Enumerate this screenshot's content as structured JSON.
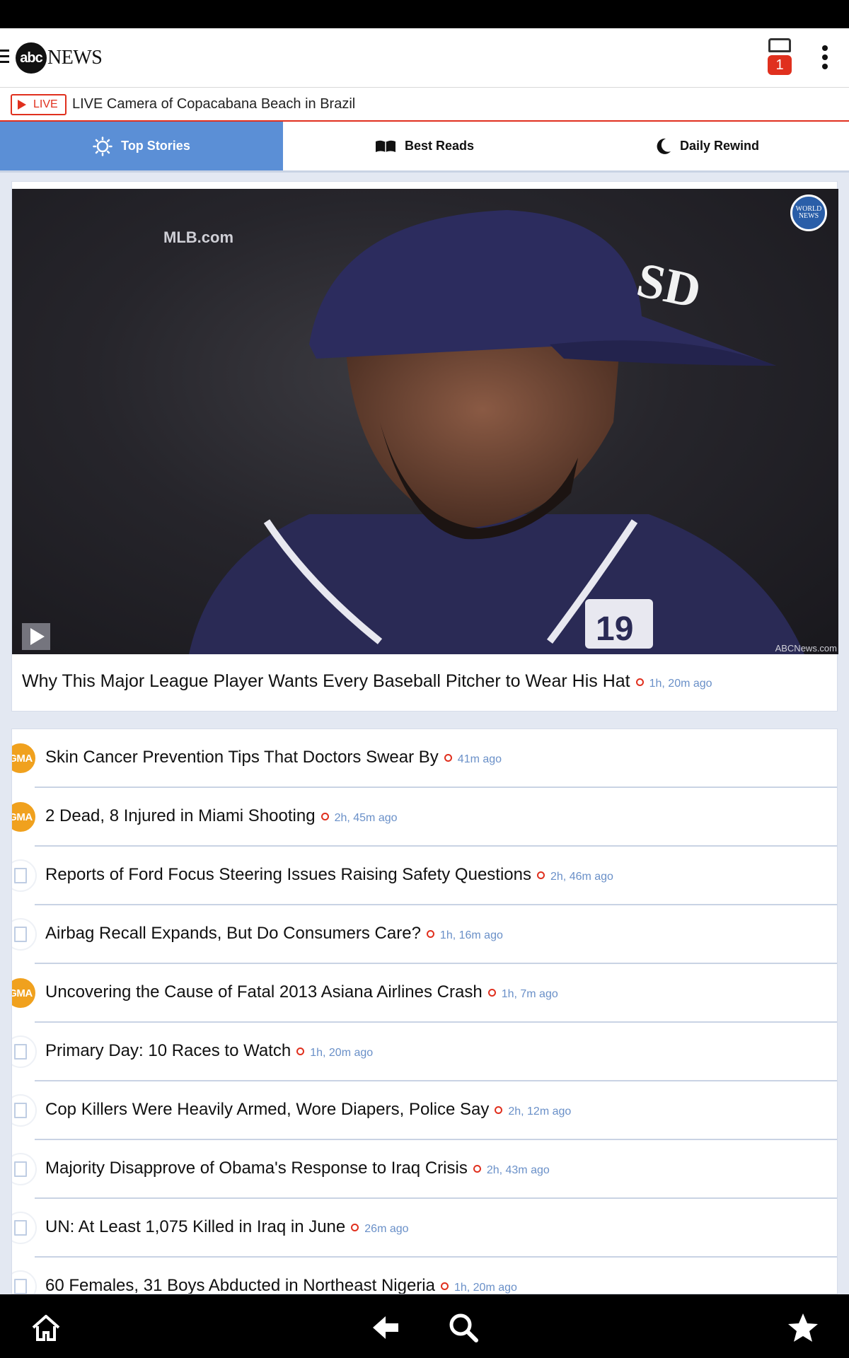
{
  "app": {
    "logo_mark": "abc",
    "logo_text": "NEWS",
    "notification_count": "1"
  },
  "live": {
    "badge_label": "LIVE",
    "text": "LIVE Camera of Copacabana Beach in Brazil"
  },
  "tabs": [
    {
      "label": "Top Stories",
      "icon": "sun-icon",
      "active": true
    },
    {
      "label": "Best Reads",
      "icon": "open-book-icon",
      "active": false
    },
    {
      "label": "Daily Rewind",
      "icon": "moon-icon",
      "active": false
    }
  ],
  "hero": {
    "watermark": "MLB.com",
    "badge_text_1": "WORLD",
    "badge_text_2": "NEWS",
    "credit": "ABCNews.com",
    "jersey_number": "19",
    "title": "Why This Major League Player Wants Every Baseball Pitcher to Wear His Hat",
    "time": "1h, 20m ago"
  },
  "stories": [
    {
      "title": "Skin Cancer Prevention Tips That Doctors Swear By",
      "time": "41m ago",
      "source": "gma"
    },
    {
      "title": "2 Dead, 8 Injured in Miami Shooting",
      "time": "2h, 45m ago",
      "source": "gma"
    },
    {
      "title": "Reports of Ford Focus Steering Issues Raising Safety Questions",
      "time": "2h, 46m ago",
      "source": "article"
    },
    {
      "title": "Airbag Recall Expands, But Do Consumers Care?",
      "time": "1h, 16m ago",
      "source": "article"
    },
    {
      "title": "Uncovering the Cause of Fatal 2013 Asiana Airlines Crash",
      "time": "1h, 7m ago",
      "source": "gma"
    },
    {
      "title": "Primary Day: 10 Races to Watch",
      "time": "1h, 20m ago",
      "source": "article"
    },
    {
      "title": "Cop Killers Were Heavily Armed, Wore Diapers, Police Say",
      "time": "2h, 12m ago",
      "source": "article"
    },
    {
      "title": "Majority Disapprove of Obama's Response to Iraq Crisis",
      "time": "2h, 43m ago",
      "source": "article"
    },
    {
      "title": "UN: At Least 1,075 Killed in Iraq in June",
      "time": "26m ago",
      "source": "article"
    },
    {
      "title": "60 Females, 31 Boys Abducted in Northeast Nigeria",
      "time": "1h, 20m ago",
      "source": "article"
    }
  ],
  "gma_label": "GMA",
  "colors": {
    "accent": "#5b8fd6",
    "live_red": "#e0301e",
    "gma_orange": "#f0a11e",
    "timestamp": "#6a90c8"
  },
  "bottom_nav": [
    "home-icon",
    "back-arrow-icon",
    "search-icon",
    "star-icon"
  ]
}
